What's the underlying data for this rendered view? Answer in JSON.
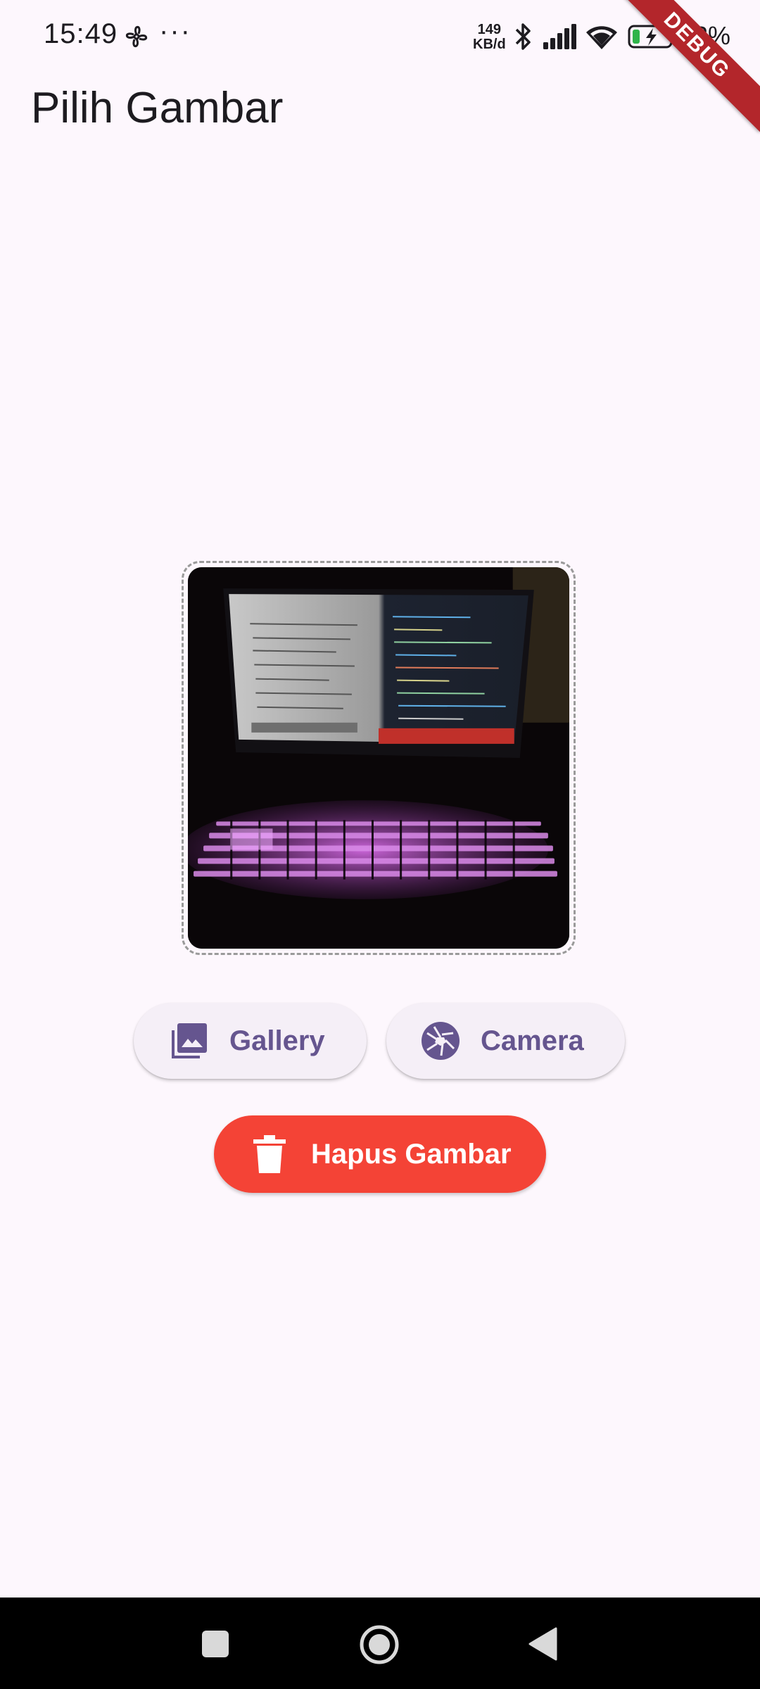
{
  "status_bar": {
    "time": "15:49",
    "dots": "···",
    "net_speed_value": "149",
    "net_speed_unit": "KB/d",
    "battery_percent": "12%",
    "icons": [
      "fan-icon",
      "bluetooth-icon",
      "signal-icon",
      "wifi-icon",
      "battery-charging-icon"
    ]
  },
  "debug_banner": "DEBUG",
  "app_bar": {
    "title": "Pilih Gambar"
  },
  "preview": {
    "icon": "laptop-photo",
    "description_colors": {
      "keyboard_glow": "#c850e0"
    }
  },
  "actions": {
    "gallery_label": "Gallery",
    "camera_label": "Camera",
    "delete_label": "Hapus Gambar"
  },
  "colors": {
    "primary": "#65558f",
    "danger": "#f44336",
    "background": "#fdf7fd"
  }
}
